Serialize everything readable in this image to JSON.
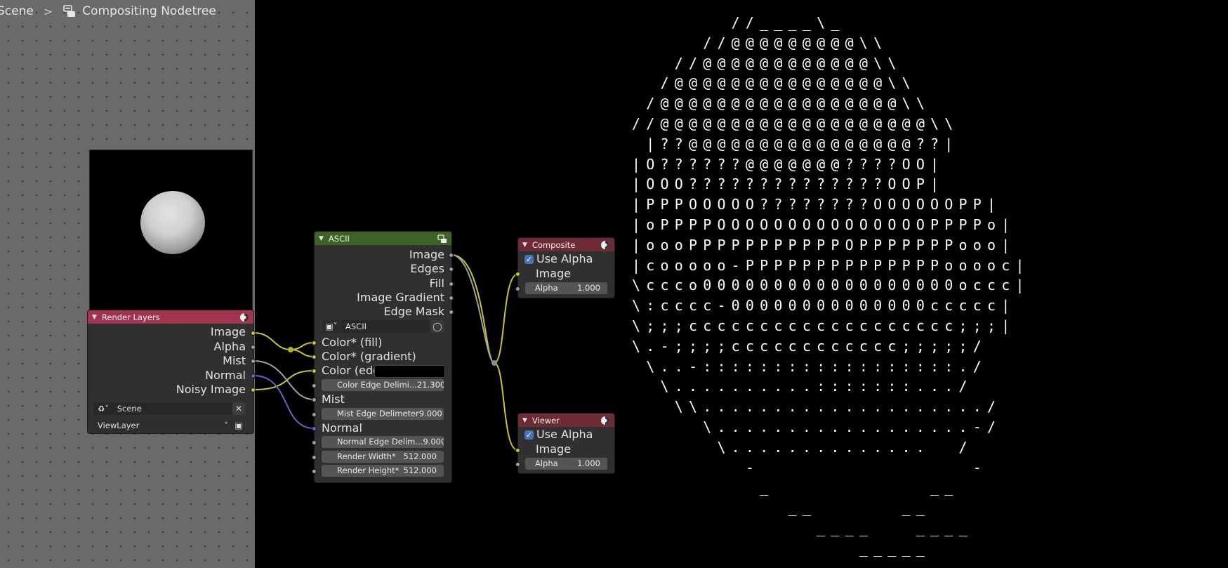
{
  "breadcrumb": {
    "scene": "Scene",
    "separator": ">",
    "nodetree_icon": "nodetree-icon",
    "nodetree": "Compositing Nodetree"
  },
  "colors": {
    "render_layers_header": "#a1344f",
    "ascii_header": "#3c6424",
    "output_header": "#6e2b35",
    "socket_color": "#c7c729",
    "socket_value": "#a1a1a1",
    "socket_vector": "#6363c7",
    "checkbox": "#4772b3"
  },
  "render_layers": {
    "title": "Render Layers",
    "outputs": [
      "Image",
      "Alpha",
      "Mist",
      "Normal",
      "Noisy Image"
    ],
    "scene_value": "Scene",
    "view_layer_value": "ViewLayer"
  },
  "ascii_node": {
    "title": "ASCII",
    "outputs": [
      "Image",
      "Edges",
      "Fill",
      "Image Gradient",
      "Edge Mask"
    ],
    "group_name": "ASCII",
    "inputs": {
      "color_fill": "Color* (fill)",
      "color_gradient": "Color* (gradient)",
      "color_edge": "Color (edge)",
      "mist": "Mist",
      "normal": "Normal"
    },
    "fields": [
      {
        "label": "Color Edge Delimi...",
        "value": "21.300"
      },
      {
        "label": "Mist Edge Delimeter",
        "value": "9.000"
      },
      {
        "label": "Normal Edge Delim...",
        "value": "9.000"
      },
      {
        "label": "Render Width*",
        "value": "512.000"
      },
      {
        "label": "Render Height*",
        "value": "512.000"
      }
    ],
    "mist_field": {
      "label": "Mist Edge Delimeter",
      "value": "9.000"
    }
  },
  "composite": {
    "title": "Composite",
    "use_alpha": "Use Alpha",
    "use_alpha_checked": true,
    "image": "Image",
    "alpha_label": "Alpha",
    "alpha_value": "1.000"
  },
  "viewer": {
    "title": "Viewer",
    "use_alpha": "Use Alpha",
    "use_alpha_checked": true,
    "image": "Image",
    "alpha_label": "Alpha",
    "alpha_value": "1.000"
  },
  "ascii_render": {
    "lines": [
      "       //____\\_",
      "     //@@@@@@@@@\\\\",
      "   //@@@@@@@@@@@@\\\\",
      "  /@@@@@@@@@@@@@@@\\\\",
      " /@@@@@@@@@@@@@@@@@\\\\",
      "//@@@@@@@@@@@@@@@@@@@\\\\",
      " |??@@@@@@@@@@@@@@@@??|",
      "|O??????@@@@@@@????OO|",
      "|OOO??????????????OOP|",
      "|PPPOOOOO????????OOOOOOPP|",
      "|oPPPPOOOOOOOOOOOOOOOPPPPo|",
      "|oooPPPPPPPPPPPOPPPPPPPooo|",
      "|cooooo-PPPPPPPPPPPPPPooooc|",
      "\\ccco000000000000000000occc|",
      "\\:cccc-00000000000000ccccc|",
      "\\;;;ccccccccccccccccccc;;;|",
      "\\.-;;;;cccccccccccc;;;;;/",
      " \\..-::::::::::::::::::./",
      "  \\..........:::::::.../",
      "   \\\\..................../",
      "     \\..................-/",
      "      \\..............  /",
      "        -               -",
      "         _           __",
      "           __      __",
      "             ____   ____",
      "                _____"
    ]
  }
}
